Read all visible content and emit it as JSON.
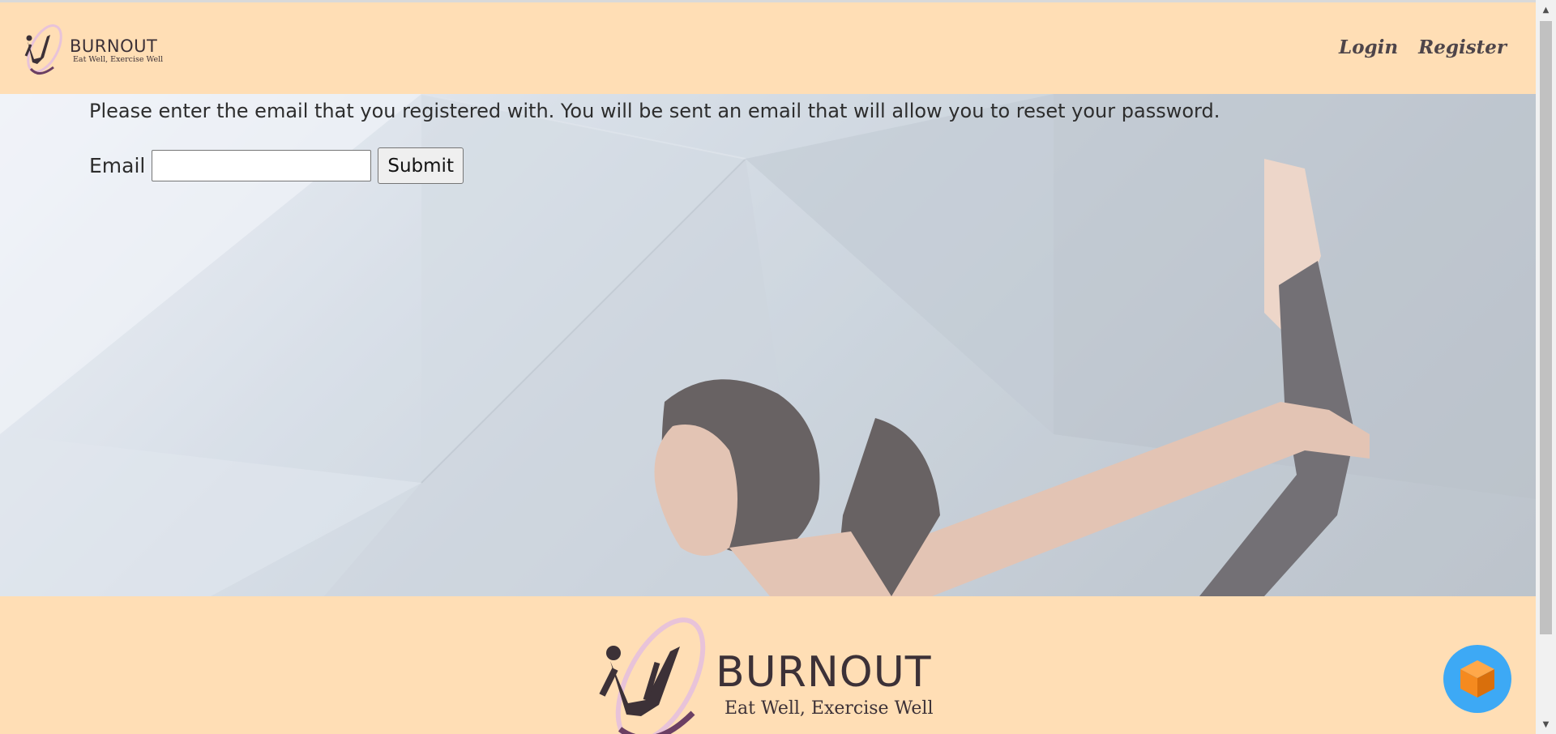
{
  "header": {
    "logo": {
      "brand": "BURNOUT",
      "tagline": "Eat Well, Exercise Well"
    },
    "nav": {
      "login": "Login",
      "register": "Register"
    }
  },
  "main": {
    "instructions": "Please enter the email that you registered with. You will be sent an email that will allow you to reset your password.",
    "email_label": "Email",
    "email_value": "",
    "submit_label": "Submit"
  },
  "footer": {
    "logo": {
      "brand": "BURNOUT",
      "tagline": "Eat Well, Exercise Well"
    }
  },
  "chat_widget": {
    "icon": "cube-icon"
  },
  "colors": {
    "header_bg": "#ffdeb5",
    "text_dark": "#3c3137",
    "logo_ring": "#9a6b8c",
    "chat_button": "#3da9f5",
    "chat_cube": "#f58a1f"
  }
}
